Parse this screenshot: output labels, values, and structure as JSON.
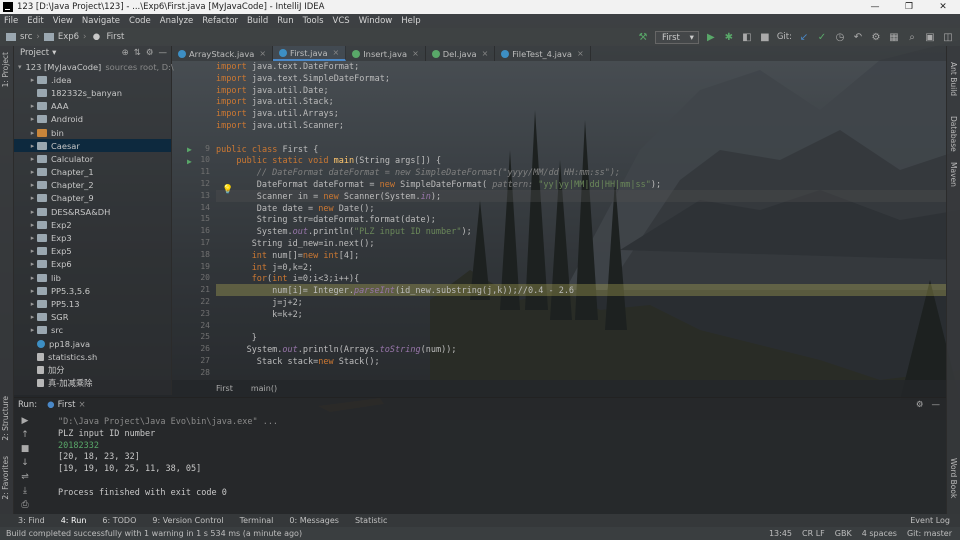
{
  "window": {
    "title": "123 [D:\\Java Project\\123] - ...\\Exp6\\First.java [MyJavaCode] - IntelliJ IDEA",
    "minimize": "—",
    "maximize": "❐",
    "close": "✕"
  },
  "menu": [
    "File",
    "Edit",
    "View",
    "Navigate",
    "Code",
    "Analyze",
    "Refactor",
    "Build",
    "Run",
    "Tools",
    "VCS",
    "Window",
    "Help"
  ],
  "toolbar": {
    "crumbs": [
      "src",
      "Exp6",
      "First"
    ],
    "run_config": "First",
    "git_label": "Git:"
  },
  "left_tabs": [
    "1: Project",
    "2: Structure",
    "2: Favorites"
  ],
  "right_tabs": [
    "Ant Build",
    "Database",
    "Maven",
    "Word Book"
  ],
  "project": {
    "header": "Project",
    "items": [
      {
        "label": "123 [MyJavaCode]",
        "extra": "sources root, D:\\",
        "depth": 0,
        "arrow": "▾",
        "icon": "folder"
      },
      {
        "label": ".idea",
        "depth": 1,
        "arrow": "▸",
        "icon": "folder"
      },
      {
        "label": "182332s_banyan",
        "depth": 1,
        "arrow": "",
        "icon": "folder"
      },
      {
        "label": "AAA",
        "depth": 1,
        "arrow": "▸",
        "icon": "folder"
      },
      {
        "label": "Android",
        "depth": 1,
        "arrow": "▸",
        "icon": "folder"
      },
      {
        "label": "bin",
        "depth": 1,
        "arrow": "▸",
        "icon": "orange"
      },
      {
        "label": "Caesar",
        "depth": 1,
        "arrow": "▸",
        "icon": "folder",
        "selected": true
      },
      {
        "label": "Calculator",
        "depth": 1,
        "arrow": "▸",
        "icon": "folder"
      },
      {
        "label": "Chapter_1",
        "depth": 1,
        "arrow": "▸",
        "icon": "folder"
      },
      {
        "label": "Chapter_2",
        "depth": 1,
        "arrow": "▸",
        "icon": "folder"
      },
      {
        "label": "Chapter_9",
        "depth": 1,
        "arrow": "▸",
        "icon": "folder"
      },
      {
        "label": "DES&RSA&DH",
        "depth": 1,
        "arrow": "▸",
        "icon": "folder"
      },
      {
        "label": "Exp2",
        "depth": 1,
        "arrow": "▸",
        "icon": "folder"
      },
      {
        "label": "Exp3",
        "depth": 1,
        "arrow": "▸",
        "icon": "folder"
      },
      {
        "label": "Exp5",
        "depth": 1,
        "arrow": "▸",
        "icon": "folder"
      },
      {
        "label": "Exp6",
        "depth": 1,
        "arrow": "▸",
        "icon": "folder"
      },
      {
        "label": "lib",
        "depth": 1,
        "arrow": "▸",
        "icon": "folder"
      },
      {
        "label": "PP5.3,5.6",
        "depth": 1,
        "arrow": "▸",
        "icon": "folder"
      },
      {
        "label": "PP5.13",
        "depth": 1,
        "arrow": "▸",
        "icon": "folder"
      },
      {
        "label": "SGR",
        "depth": 1,
        "arrow": "▸",
        "icon": "folder"
      },
      {
        "label": "src",
        "depth": 1,
        "arrow": "▸",
        "icon": "folder"
      },
      {
        "label": "pp18.java",
        "depth": 1,
        "arrow": "",
        "icon": "java"
      },
      {
        "label": "statistics.sh",
        "depth": 1,
        "arrow": "",
        "icon": "file"
      },
      {
        "label": "加分",
        "depth": 1,
        "arrow": "",
        "icon": "file"
      },
      {
        "label": "真-加减乘除",
        "depth": 1,
        "arrow": "",
        "icon": "file"
      }
    ]
  },
  "tabs": [
    {
      "label": "ArrayStack.java",
      "icon": "c",
      "active": false
    },
    {
      "label": "First.java",
      "icon": "c",
      "active": true
    },
    {
      "label": "Insert.java",
      "icon": "g",
      "active": false
    },
    {
      "label": "Del.java",
      "icon": "g",
      "active": false
    },
    {
      "label": "FileTest_4.java",
      "icon": "c",
      "active": false
    }
  ],
  "code": {
    "line_numbers": [
      "",
      "",
      "",
      "",
      "",
      "",
      "",
      "9",
      "10",
      "11",
      "12",
      "13",
      "14",
      "15",
      "16",
      "17",
      "18",
      "19",
      "20",
      "21",
      "22",
      "23",
      "24",
      "25",
      "26",
      "27",
      "28"
    ],
    "lines": [
      {
        "indent": 0,
        "parts": [
          [
            "kw",
            "import "
          ],
          [
            "",
            "java.text.DateFormat;"
          ]
        ]
      },
      {
        "indent": 0,
        "parts": [
          [
            "kw",
            "import "
          ],
          [
            "",
            "java.text.SimpleDateFormat;"
          ]
        ]
      },
      {
        "indent": 0,
        "parts": [
          [
            "kw",
            "import "
          ],
          [
            "",
            "java.util.Date;"
          ]
        ]
      },
      {
        "indent": 0,
        "parts": [
          [
            "kw",
            "import "
          ],
          [
            "",
            "java.util.Stack;"
          ]
        ]
      },
      {
        "indent": 0,
        "parts": [
          [
            "kw",
            "import "
          ],
          [
            "",
            "java.util.Arrays;"
          ]
        ]
      },
      {
        "indent": 0,
        "parts": [
          [
            "kw",
            "import "
          ],
          [
            "",
            "java.util.Scanner;"
          ]
        ]
      },
      {
        "indent": 0,
        "parts": [
          [
            "",
            ""
          ]
        ]
      },
      {
        "indent": 0,
        "parts": [
          [
            "kw",
            "public class "
          ],
          [
            "",
            "First {"
          ]
        ]
      },
      {
        "indent": 4,
        "parts": [
          [
            "kw",
            "public static void "
          ],
          [
            "fn",
            "main"
          ],
          [
            "",
            "(String args[])"
          ],
          [
            "",
            " {"
          ]
        ]
      },
      {
        "indent": 8,
        "parts": [
          [
            "cm",
            "// DateFormat dateFormat = new SimpleDateFormat(\"yyyy/MM/dd HH:mm:ss\");"
          ]
        ]
      },
      {
        "indent": 8,
        "parts": [
          [
            "",
            "DateFormat dateFormat = "
          ],
          [
            "kw",
            "new "
          ],
          [
            "",
            "SimpleDateFormat( "
          ],
          [
            "cm",
            "pattern: "
          ],
          [
            "str",
            "\"yy|yy|MM|dd|HH|mm|ss\""
          ],
          [
            "",
            ");"
          ]
        ]
      },
      {
        "indent": 8,
        "parts": [
          [
            "",
            "Scanner in = "
          ],
          [
            "kw",
            "new "
          ],
          [
            "",
            "Scanner(System."
          ],
          [
            "it",
            "in"
          ],
          [
            "",
            ");"
          ]
        ]
      },
      {
        "indent": 8,
        "parts": [
          [
            "",
            "Date date = "
          ],
          [
            "kw",
            "new "
          ],
          [
            "",
            "Date();"
          ]
        ]
      },
      {
        "indent": 8,
        "parts": [
          [
            "",
            "String str=dateFormat.format(date);"
          ]
        ]
      },
      {
        "indent": 8,
        "parts": [
          [
            "",
            "System."
          ],
          [
            "it",
            "out"
          ],
          [
            "",
            ".println("
          ],
          [
            "str",
            "\"PLZ input ID number\""
          ],
          [
            "",
            ");"
          ]
        ]
      },
      {
        "indent": 7,
        "parts": [
          [
            "",
            "String id_new=in.next();"
          ]
        ]
      },
      {
        "indent": 7,
        "parts": [
          [
            "kw",
            "int "
          ],
          [
            "",
            "num[]="
          ],
          [
            "kw",
            "new int"
          ],
          [
            "",
            "[4];"
          ]
        ]
      },
      {
        "indent": 7,
        "parts": [
          [
            "kw",
            "int "
          ],
          [
            "",
            "j=0,k=2;"
          ]
        ]
      },
      {
        "indent": 7,
        "parts": [
          [
            "kw",
            "for"
          ],
          [
            "",
            "("
          ],
          [
            "kw",
            "int "
          ],
          [
            "",
            "i=0;i<3;i++){"
          ]
        ]
      },
      {
        "indent": 11,
        "parts": [
          [
            "",
            "num[i]= Integer."
          ],
          [
            "it",
            "parseInt"
          ],
          [
            "",
            "(id_new.substring(j,k));//0.4 - 2.6"
          ]
        ]
      },
      {
        "indent": 11,
        "parts": [
          [
            "",
            "j=j+2;"
          ]
        ]
      },
      {
        "indent": 11,
        "parts": [
          [
            "",
            "k=k+2;"
          ]
        ]
      },
      {
        "indent": 0,
        "parts": [
          [
            "",
            ""
          ]
        ]
      },
      {
        "indent": 7,
        "parts": [
          [
            "",
            "}"
          ]
        ]
      },
      {
        "indent": 6,
        "parts": [
          [
            "",
            "System."
          ],
          [
            "it",
            "out"
          ],
          [
            "",
            ".println(Arrays."
          ],
          [
            "it",
            "toString"
          ],
          [
            "",
            "(num));"
          ]
        ]
      },
      {
        "indent": 8,
        "parts": [
          [
            "",
            "Stack stack="
          ],
          [
            "kw",
            "new "
          ],
          [
            "",
            "Stack();"
          ]
        ]
      }
    ]
  },
  "editor_breadcrumb": [
    "First",
    "main()"
  ],
  "run": {
    "label": "Run:",
    "config": "First",
    "console": [
      {
        "cls": "path",
        "text": "\"D:\\Java Project\\Java Evo\\bin\\java.exe\" ..."
      },
      {
        "cls": "",
        "text": "PLZ input ID number"
      },
      {
        "cls": "input",
        "text": "20182332"
      },
      {
        "cls": "",
        "text": "[20, 18, 23, 32]"
      },
      {
        "cls": "",
        "text": "[19, 19, 10, 25, 11, 38, 05]"
      },
      {
        "cls": "",
        "text": ""
      },
      {
        "cls": "",
        "text": "Process finished with exit code 0"
      }
    ]
  },
  "bottom_tools": [
    "3: Find",
    "4: Run",
    "6: TODO",
    "9: Version Control",
    "Terminal",
    "0: Messages",
    "Statistic"
  ],
  "event_log": "Event Log",
  "status": {
    "message": "Build completed successfully with 1 warning in 1 s 534 ms (a minute ago)",
    "position": "13:45",
    "sep": "CR LF",
    "encoding": "GBK",
    "indent": "4 spaces",
    "git": "Git: master"
  }
}
